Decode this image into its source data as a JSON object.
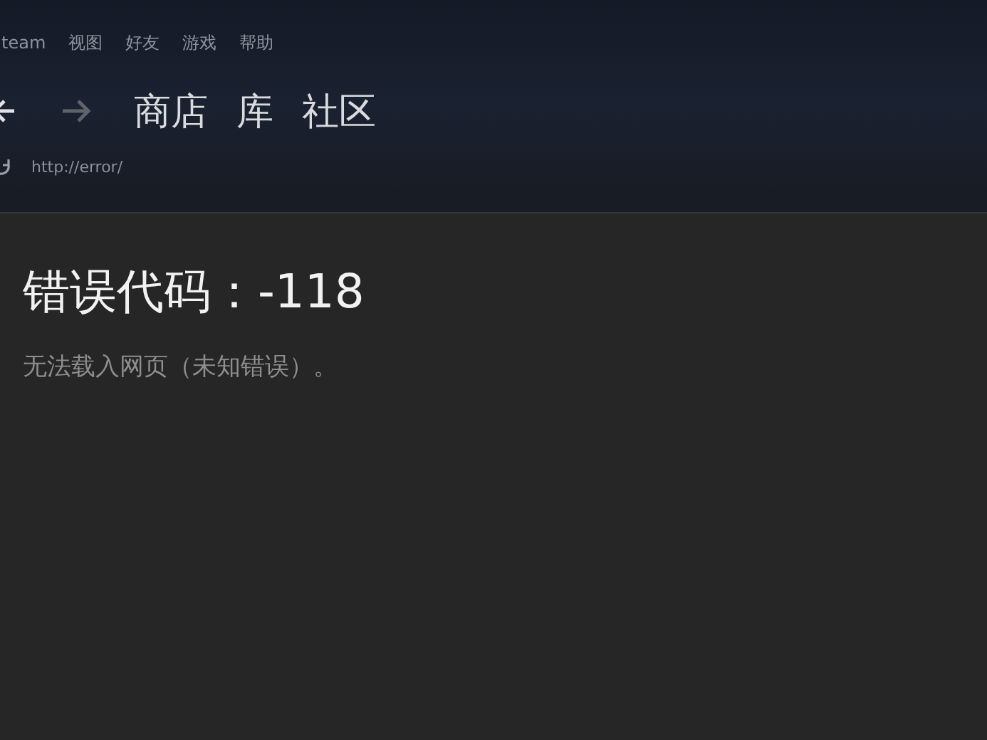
{
  "menu": [
    "team",
    "视图",
    "好友",
    "游戏",
    "帮助"
  ],
  "nav": [
    "商店",
    "库",
    "社区"
  ],
  "address": {
    "value": "http://error/"
  },
  "error": {
    "title": "错误代码：-118",
    "message": "无法载入网页（未知错误）。"
  }
}
